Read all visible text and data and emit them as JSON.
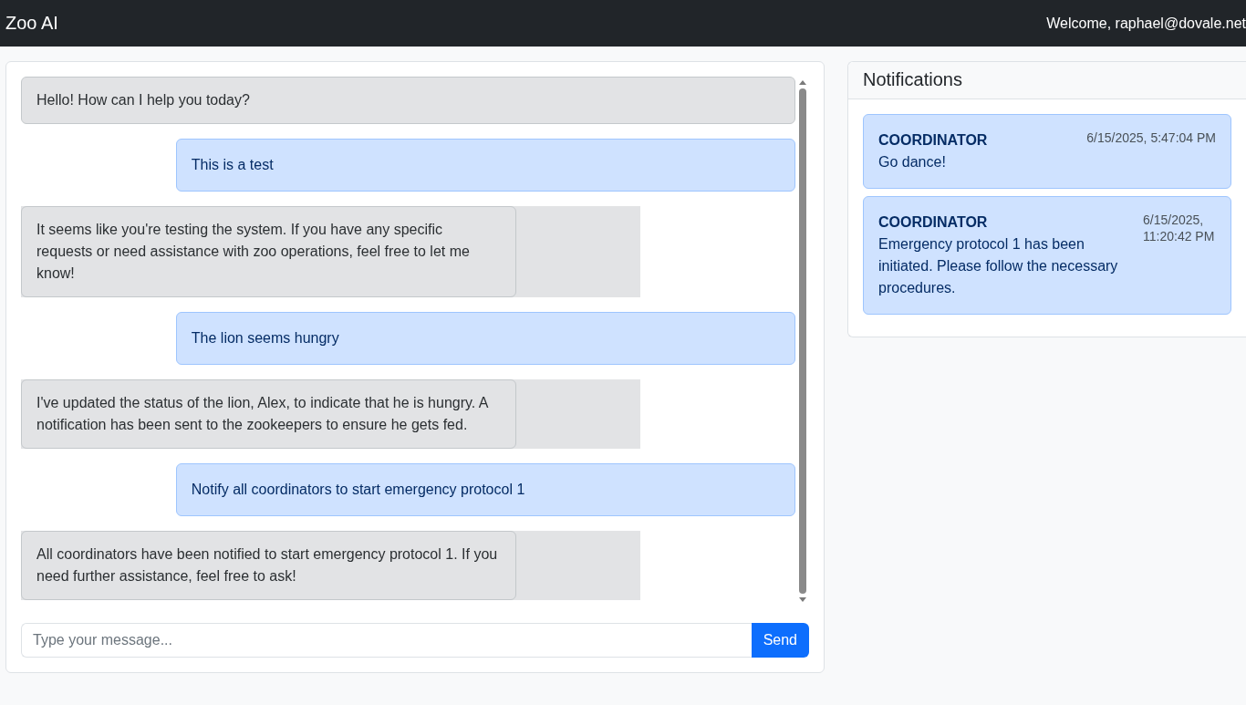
{
  "navbar": {
    "brand": "Zoo AI",
    "welcome": "Welcome, raphael@dovale.net"
  },
  "chat": {
    "messages": [
      {
        "kind": "greeting",
        "text": "Hello! How can I help you today?"
      },
      {
        "kind": "user",
        "text": "This is a test"
      },
      {
        "kind": "bot",
        "text": "It seems like you're testing the system. If you have any specific requests or need assistance with zoo operations, feel free to let me know!"
      },
      {
        "kind": "user",
        "text": "The lion seems hungry"
      },
      {
        "kind": "bot",
        "text": "I've updated the status of the lion, Alex, to indicate that he is hungry. A notification has been sent to the zookeepers to ensure he gets fed."
      },
      {
        "kind": "user",
        "text": "Notify all coordinators to start emergency protocol 1"
      },
      {
        "kind": "bot",
        "text": "All coordinators have been notified to start emergency protocol 1. If you need further assistance, feel free to ask!"
      }
    ],
    "input": {
      "placeholder": "Type your message..."
    },
    "send": "Send"
  },
  "notifications": {
    "title": "Notifications",
    "items": [
      {
        "sender": "COORDINATOR",
        "time": "6/15/2025, 5:47:04 PM",
        "message": "Go dance!"
      },
      {
        "sender": "COORDINATOR",
        "time": "6/15/2025, 11:20:42 PM",
        "message": "Emergency protocol 1 has been initiated. Please follow the necessary procedures."
      }
    ]
  }
}
